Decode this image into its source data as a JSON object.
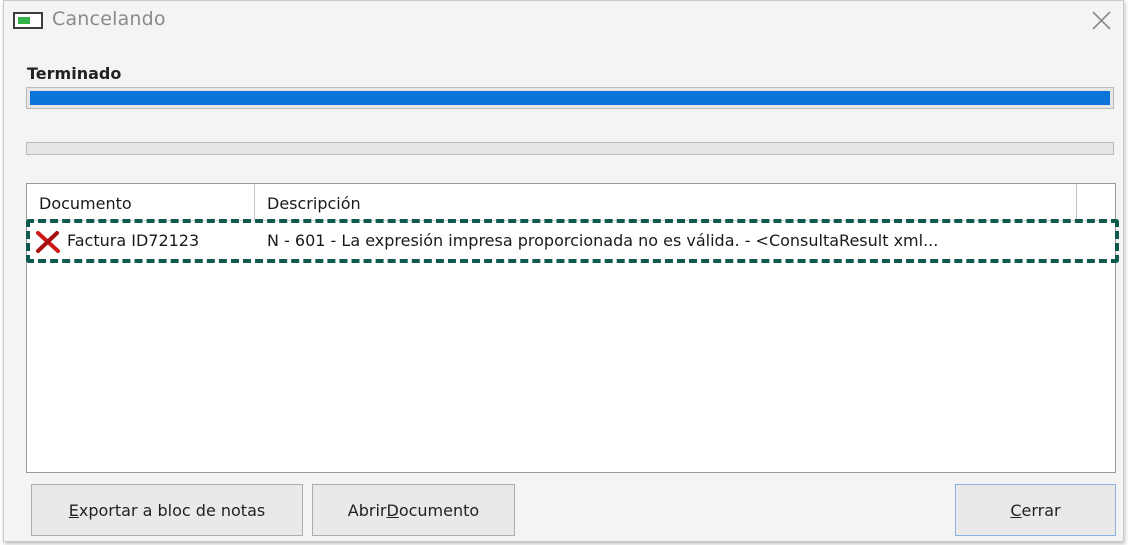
{
  "window": {
    "title": "Cancelando",
    "close_icon": "close-icon",
    "app_icon": "window-app-icon"
  },
  "status": {
    "label": "Terminado",
    "main_progress": 1.0,
    "secondary_progress": 0.0
  },
  "list": {
    "columns": [
      "Documento",
      "Descripción",
      ""
    ],
    "rows": [
      {
        "status_icon": "error-x-icon",
        "documento": "Factura ID72123",
        "descripcion": "N - 601 - La expresión impresa proporcionada no es válida. - <ConsultaResult xml..."
      }
    ]
  },
  "buttons": {
    "export": {
      "pre": "",
      "accel": "E",
      "post": "xportar a bloc de notas"
    },
    "open": {
      "pre": "Abrir ",
      "accel": "D",
      "post": "ocumento"
    },
    "close": {
      "pre": "",
      "accel": "C",
      "post": "errar"
    }
  },
  "colors": {
    "progress_fill": "#0a74d8",
    "highlight_border": "#0f5a4e",
    "error_icon": "#d01818"
  }
}
